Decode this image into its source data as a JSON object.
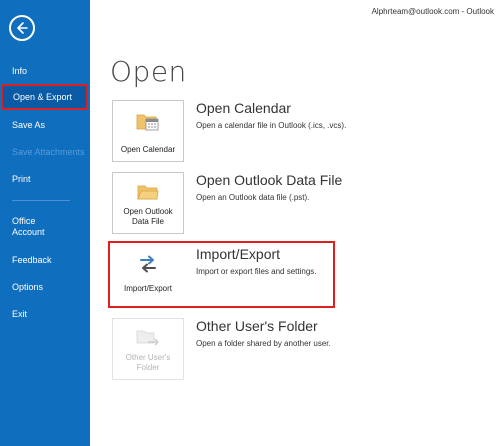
{
  "account_label": "Alphrteam@outlook.com  -  Outlook",
  "sidebar": {
    "items": [
      {
        "label": "Info"
      },
      {
        "label": "Open & Export"
      },
      {
        "label": "Save As"
      },
      {
        "label": "Save Attachments"
      },
      {
        "label": "Print"
      },
      {
        "label": "Office Account"
      },
      {
        "label": "Feedback"
      },
      {
        "label": "Options"
      },
      {
        "label": "Exit"
      }
    ]
  },
  "page_title": "Open",
  "options": [
    {
      "tile_label": "Open Calendar",
      "title": "Open Calendar",
      "desc": "Open a calendar file in Outlook (.ics, .vcs)."
    },
    {
      "tile_label": "Open Outlook Data File",
      "title": "Open Outlook Data File",
      "desc": "Open an Outlook data file (.pst)."
    },
    {
      "tile_label": "Import/Export",
      "title": "Import/Export",
      "desc": "Import or export files and settings."
    },
    {
      "tile_label": "Other User's Folder",
      "title": "Other User's Folder",
      "desc": "Open a folder shared by another user."
    }
  ],
  "colors": {
    "sidebar": "#106ebe",
    "highlight": "#e0201f"
  }
}
